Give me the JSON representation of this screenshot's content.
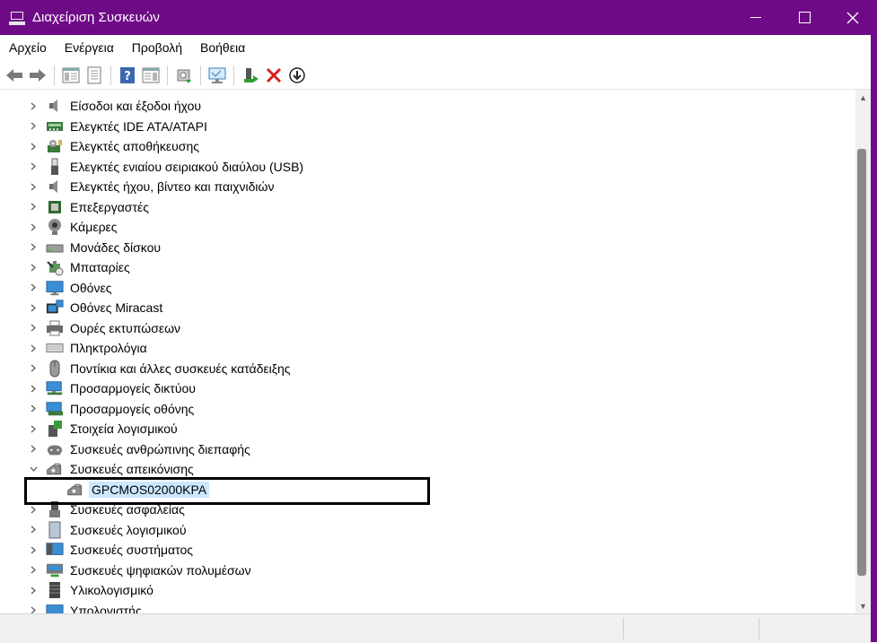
{
  "window": {
    "title": "Διαχείριση Συσκευών",
    "accent": "#6f0a87"
  },
  "menu": [
    "Αρχείο",
    "Ενέργεια",
    "Προβολή",
    "Βοήθεια"
  ],
  "toolbar": {
    "buttons": [
      "back-icon",
      "forward-icon",
      "console-tree-icon",
      "properties-icon",
      "help-icon",
      "action-pane-icon",
      "update-driver-icon",
      "scan-hardware-icon",
      "enable-device-icon",
      "uninstall-icon",
      "disable-device-icon"
    ]
  },
  "tree": {
    "items": [
      {
        "label": "Είσοδοι και έξοδοι ήχου",
        "icon": "speaker-icon",
        "expanded": false
      },
      {
        "label": "Ελεγκτές IDE ATA/ATAPI",
        "icon": "ide-controller-icon",
        "expanded": false
      },
      {
        "label": "Ελεγκτές αποθήκευσης",
        "icon": "storage-controller-icon",
        "expanded": false
      },
      {
        "label": "Ελεγκτές ενιαίου σειριακού διαύλου (USB)",
        "icon": "usb-icon",
        "expanded": false
      },
      {
        "label": "Ελεγκτές ήχου, βίντεο και παιχνιδιών",
        "icon": "speaker-icon",
        "expanded": false
      },
      {
        "label": "Επεξεργαστές",
        "icon": "processor-icon",
        "expanded": false
      },
      {
        "label": "Κάμερες",
        "icon": "camera-icon",
        "expanded": false
      },
      {
        "label": "Μονάδες δίσκου",
        "icon": "disk-drive-icon",
        "expanded": false
      },
      {
        "label": "Μπαταρίες",
        "icon": "battery-icon",
        "expanded": false
      },
      {
        "label": "Οθόνες",
        "icon": "monitor-icon",
        "expanded": false
      },
      {
        "label": "Οθόνες Miracast",
        "icon": "miracast-icon",
        "expanded": false
      },
      {
        "label": "Ουρές εκτυπώσεων",
        "icon": "printer-icon",
        "expanded": false
      },
      {
        "label": "Πληκτρολόγια",
        "icon": "keyboard-icon",
        "expanded": false
      },
      {
        "label": "Ποντίκια και άλλες συσκευές κατάδειξης",
        "icon": "mouse-icon",
        "expanded": false
      },
      {
        "label": "Προσαρμογείς δικτύου",
        "icon": "network-adapter-icon",
        "expanded": false
      },
      {
        "label": "Προσαρμογείς οθόνης",
        "icon": "display-adapter-icon",
        "expanded": false
      },
      {
        "label": "Στοιχεία λογισμικού",
        "icon": "software-component-icon",
        "expanded": false
      },
      {
        "label": "Συσκευές ανθρώπινης διεπαφής",
        "icon": "hid-icon",
        "expanded": false
      },
      {
        "label": "Συσκευές απεικόνισης",
        "icon": "imaging-device-icon",
        "expanded": true
      },
      {
        "label": "GPCMOS02000KPA",
        "icon": "imaging-device-icon",
        "child": true,
        "selected": true
      },
      {
        "label": "Συσκευές ασφαλείας",
        "icon": "security-device-icon",
        "expanded": false
      },
      {
        "label": "Συσκευές λογισμικού",
        "icon": "software-device-icon",
        "expanded": false
      },
      {
        "label": "Συσκευές συστήματος",
        "icon": "system-device-icon",
        "expanded": false
      },
      {
        "label": "Συσκευές ψηφιακών πολυμέσων",
        "icon": "media-device-icon",
        "expanded": false
      },
      {
        "label": "Υλικολογισμικό",
        "icon": "firmware-icon",
        "expanded": false
      },
      {
        "label": "Υπολογιστής",
        "icon": "computer-icon",
        "expanded": false
      }
    ]
  }
}
